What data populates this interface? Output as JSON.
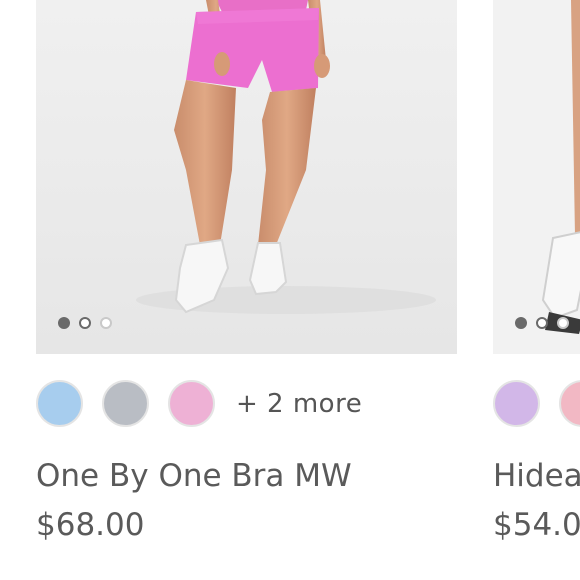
{
  "products": [
    {
      "name": "One By One Bra MW",
      "price": "$68.00",
      "more_colors": "+ 2 more",
      "swatches": [
        "#a7cdee",
        "#b9bdc4",
        "#eeb1d5"
      ],
      "carousel_dots": 3,
      "image_icon": "model-pink-bike-shorts-image"
    },
    {
      "name": "Hidea",
      "price": "$54.0",
      "swatches": [
        "#d2b7e8",
        "#f2b8c4"
      ],
      "carousel_dots": 3,
      "image_icon": "model-white-sneakers-image"
    }
  ]
}
